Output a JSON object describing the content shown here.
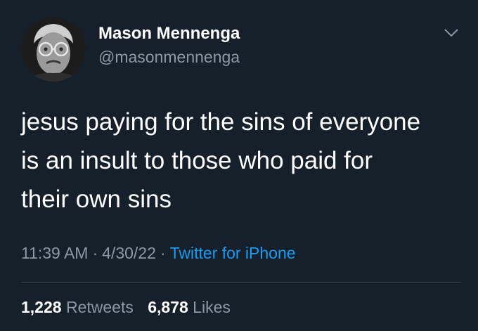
{
  "author": {
    "display_name": "Mason Mennenga",
    "handle": "@masonmennenga",
    "avatar_icon": "profile-photo"
  },
  "menu_icon": "chevron-down-icon",
  "tweet": {
    "text": "jesus paying for the sins of everyone\nis an insult to those who paid for\ntheir own sins"
  },
  "meta": {
    "time": "11:39 AM",
    "separator": "·",
    "date": "4/30/22",
    "source": "Twitter for iPhone"
  },
  "stats": {
    "retweets_count": "1,228",
    "retweets_label": "Retweets",
    "likes_count": "6,878",
    "likes_label": "Likes"
  },
  "colors": {
    "background": "#15202b",
    "primary_text": "#ffffff",
    "secondary_text": "#8b98a5",
    "link": "#1d9bf0",
    "divider": "#38444d"
  }
}
